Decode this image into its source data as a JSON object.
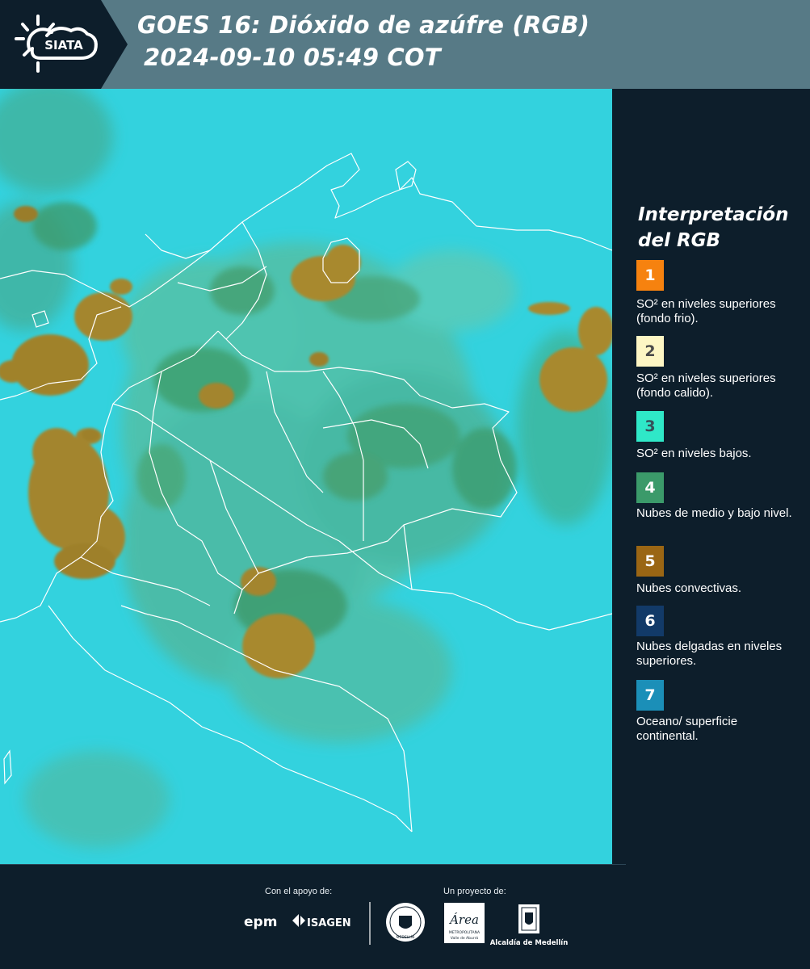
{
  "header": {
    "logo_text": "SIATA",
    "title_line1": "GOES 16: Dióxido de azúfre (RGB)",
    "title_line2": "2024-09-10 05:49 COT"
  },
  "legend": {
    "title_line1": "Interpretación",
    "title_line2": "del RGB",
    "items": [
      {
        "number": "1",
        "color": "#f6820f",
        "text_color": "#ffffff",
        "label": "SO² en niveles superiores (fondo frio)."
      },
      {
        "number": "2",
        "color": "#fdf6c4",
        "text_color": "#4a4a4a",
        "label": "SO² en niveles superiores (fondo calido)."
      },
      {
        "number": "3",
        "color": "#2fe8c8",
        "text_color": "#35505a",
        "label": "SO² en niveles bajos."
      },
      {
        "number": "4",
        "color": "#3b9a6a",
        "text_color": "#ffffff",
        "label": "Nubes de medio y bajo nivel."
      },
      {
        "number": "5",
        "color": "#9a6614",
        "text_color": "#ffffff",
        "label": "Nubes convectivas."
      },
      {
        "number": "6",
        "color": "#123a68",
        "text_color": "#ffffff",
        "label": "Nubes delgadas en niveles superiores."
      },
      {
        "number": "7",
        "color": "#1b8fb8",
        "text_color": "#ffffff",
        "label": "Oceano/ superficie continental."
      }
    ]
  },
  "footer": {
    "support_label": "Con el apoyo de:",
    "project_label": "Un proyecto de:",
    "logo_epm": "epm",
    "logo_isagen": "ISAGEN",
    "logo_medellin_seal": "MEDELLÍN",
    "logo_area": "Área",
    "logo_area_sub1": "METROPOLITANA",
    "logo_area_sub2": "Valle de Aburrá",
    "logo_alcaldia": "Alcaldía de Medellín"
  },
  "map": {
    "ocean_color": "#33d2de",
    "land_color": "#55c4a8",
    "convective_color": "#a88a2c",
    "border_color": "#ffffff"
  }
}
